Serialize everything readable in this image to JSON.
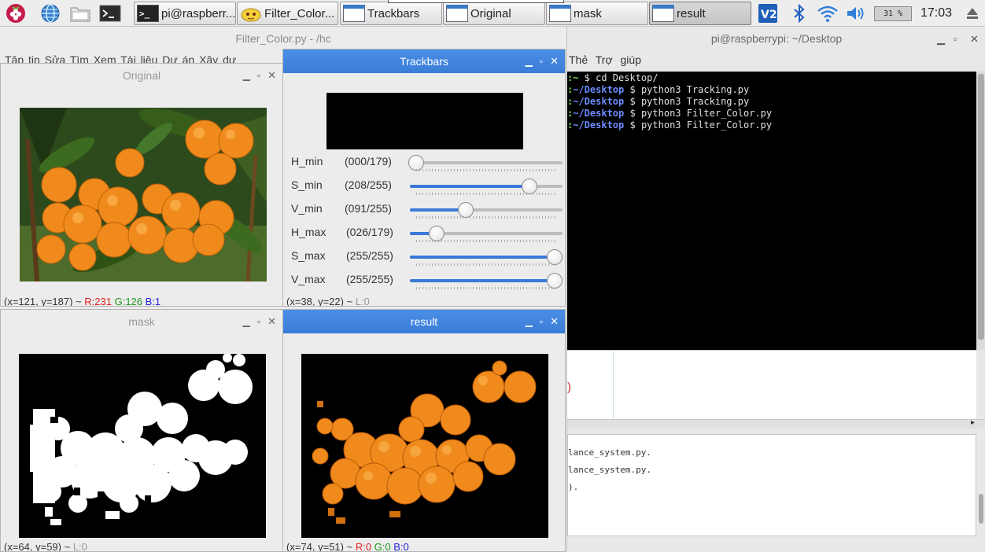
{
  "taskbar": {
    "tasks": [
      {
        "label": "pi@raspberr..."
      },
      {
        "label": "Filter_Color..."
      },
      {
        "label": "Trackbars"
      },
      {
        "label": "Original"
      },
      {
        "label": "mask"
      },
      {
        "label": "result"
      }
    ],
    "active_task": "result",
    "cpu": "31 %",
    "clock": "17:03"
  },
  "geany": {
    "title": "Filter_Color.py - /hc",
    "menu": "Tập tin  Sửa  Tìm  Xem  Tài liệu  Dự án  Xây dự"
  },
  "terminal": {
    "title": "pi@raspberrypi: ~/Desktop",
    "menu": "Thẻ  Trợ giúp",
    "lines": [
      {
        "user": ":~",
        "dir": "",
        "cmd": " $ cd Desktop/"
      },
      {
        "user": ":",
        "dir": "~/Desktop",
        "cmd": " $ python3 Tracking.py"
      },
      {
        "user": ":",
        "dir": "~/Desktop",
        "cmd": " $ python3 Tracking.py"
      },
      {
        "user": ":",
        "dir": "~/Desktop",
        "cmd": " $ python3 Filter_Color.py"
      },
      {
        "user": ":",
        "dir": "~/Desktop",
        "cmd": " $ python3 Filter_Color.py"
      }
    ],
    "editor_char": ")",
    "messages": [
      "lance_system.py.",
      "lance_system.py.",
      ")."
    ]
  },
  "windows": {
    "original": {
      "title": "Original",
      "status": {
        "pos": "(x=121, y=187) ~ ",
        "r": "R:231",
        "g": "G:126",
        "b": "B:1"
      }
    },
    "trackbars": {
      "title": "Trackbars",
      "status": {
        "pos": "(x=38, y=22) ~ ",
        "l": "L:0"
      },
      "controls": [
        {
          "name": "H_min",
          "display": "(000/179)",
          "value": 0,
          "max": 179
        },
        {
          "name": "S_min",
          "display": "(208/255)",
          "value": 208,
          "max": 255
        },
        {
          "name": "V_min",
          "display": "(091/255)",
          "value": 91,
          "max": 255
        },
        {
          "name": "H_max",
          "display": "(026/179)",
          "value": 26,
          "max": 179
        },
        {
          "name": "S_max",
          "display": "(255/255)",
          "value": 255,
          "max": 255
        },
        {
          "name": "V_max",
          "display": "(255/255)",
          "value": 255,
          "max": 255
        }
      ]
    },
    "mask": {
      "title": "mask",
      "status": {
        "pos": "(x=64, y=59) ~ ",
        "l": "L:0"
      }
    },
    "result": {
      "title": "result",
      "status": {
        "pos": "(x=74, y=51) ~ ",
        "r": "R:0",
        "g": "G:0",
        "b": "B:0"
      }
    }
  },
  "colors": {
    "accent": "#3b78d8",
    "terminal_bg": "#000000",
    "fruit": "#f08a1c"
  }
}
